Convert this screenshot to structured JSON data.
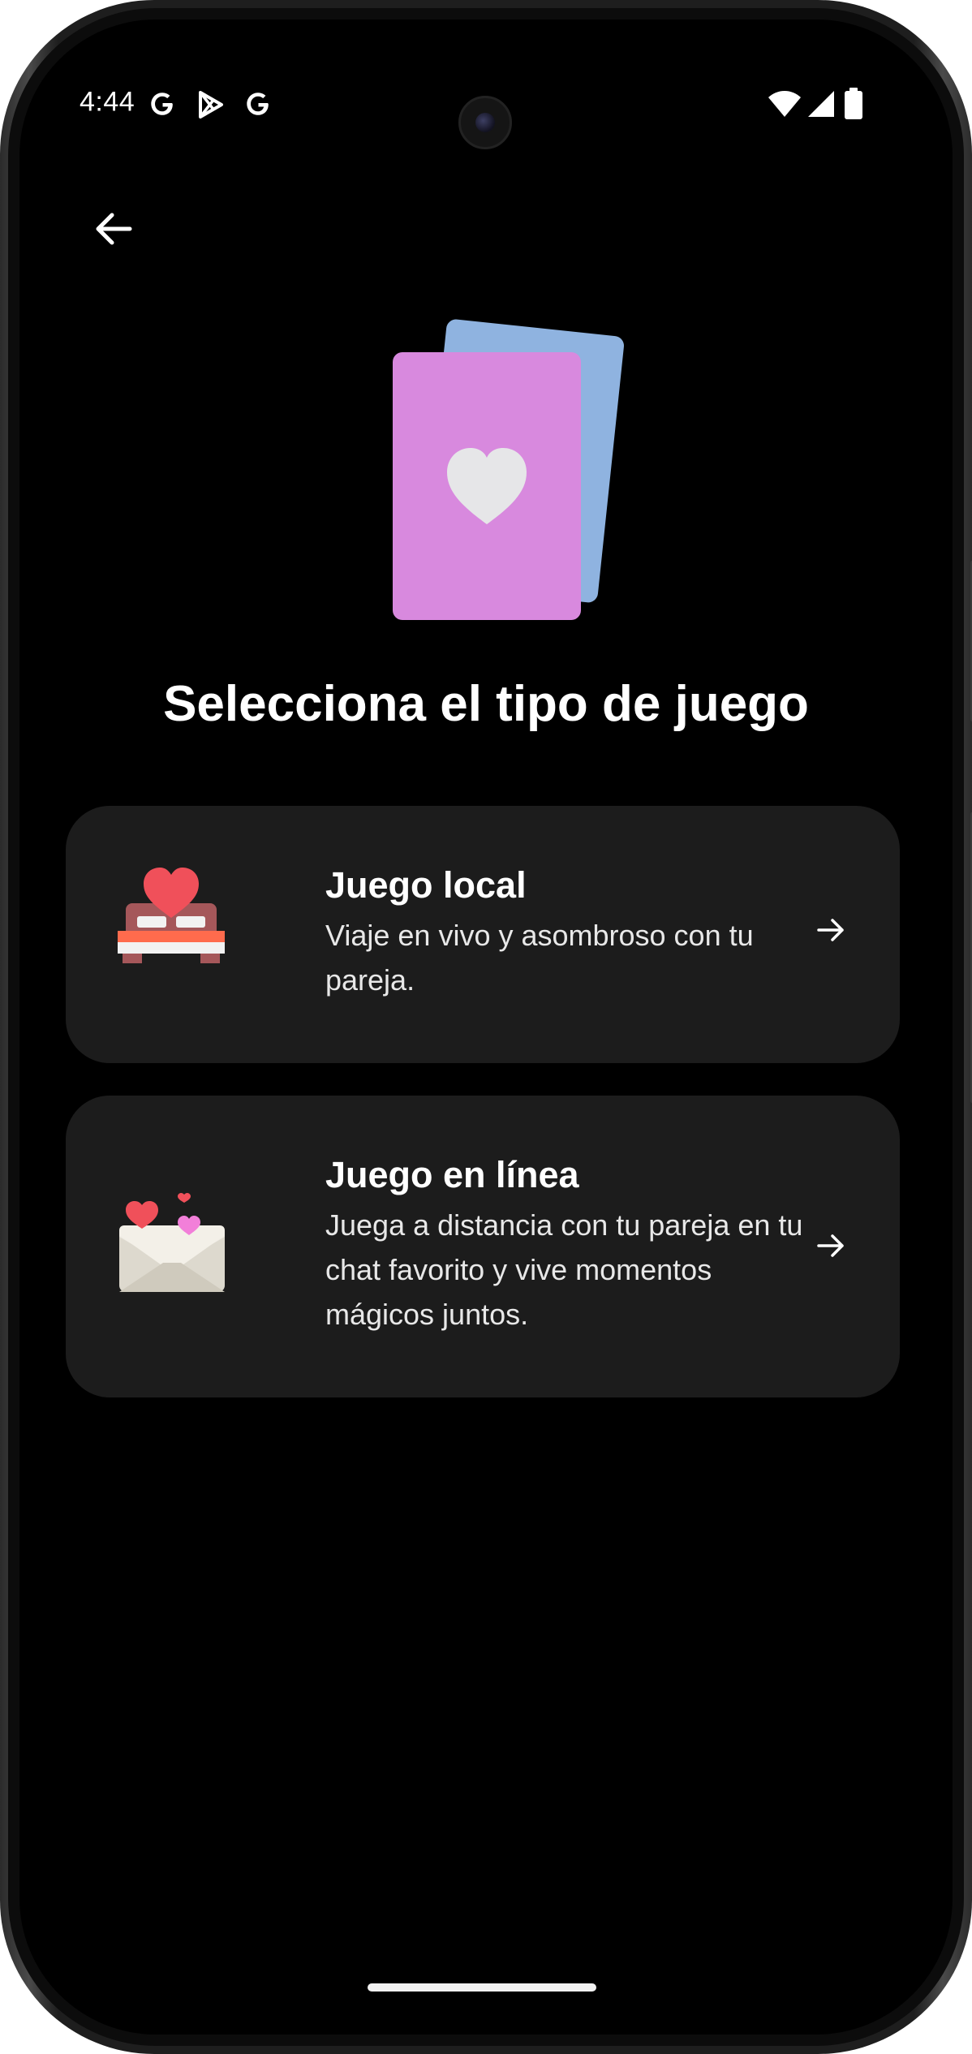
{
  "status_bar": {
    "time": "4:44",
    "icons": [
      "google-g-icon",
      "play-store-icon",
      "google-g-icon",
      "wifi-icon",
      "signal-icon",
      "battery-icon"
    ]
  },
  "navigation": {
    "back_icon": "arrow-back-icon"
  },
  "hero": {
    "illustration": "playing-cards-heart-icon",
    "colors": {
      "front_card": "#d889de",
      "back_card": "#8fb3e0",
      "heart": "#e6e6e8"
    }
  },
  "page": {
    "title": "Selecciona el tipo de juego"
  },
  "options": [
    {
      "icon": "bed-heart-icon",
      "title": "Juego local",
      "description": "Viaje en vivo y asombroso con tu pareja.",
      "arrow_icon": "arrow-forward-icon"
    },
    {
      "icon": "love-letter-icon",
      "title": "Juego en línea",
      "description": "Juega a distancia con tu pareja en tu chat favorito y vive momentos mágicos juntos.",
      "arrow_icon": "arrow-forward-icon"
    }
  ],
  "theme": {
    "background": "#000000",
    "card_background": "#1c1c1c",
    "text_primary": "#ffffff",
    "heart_red": "#f0505a"
  }
}
